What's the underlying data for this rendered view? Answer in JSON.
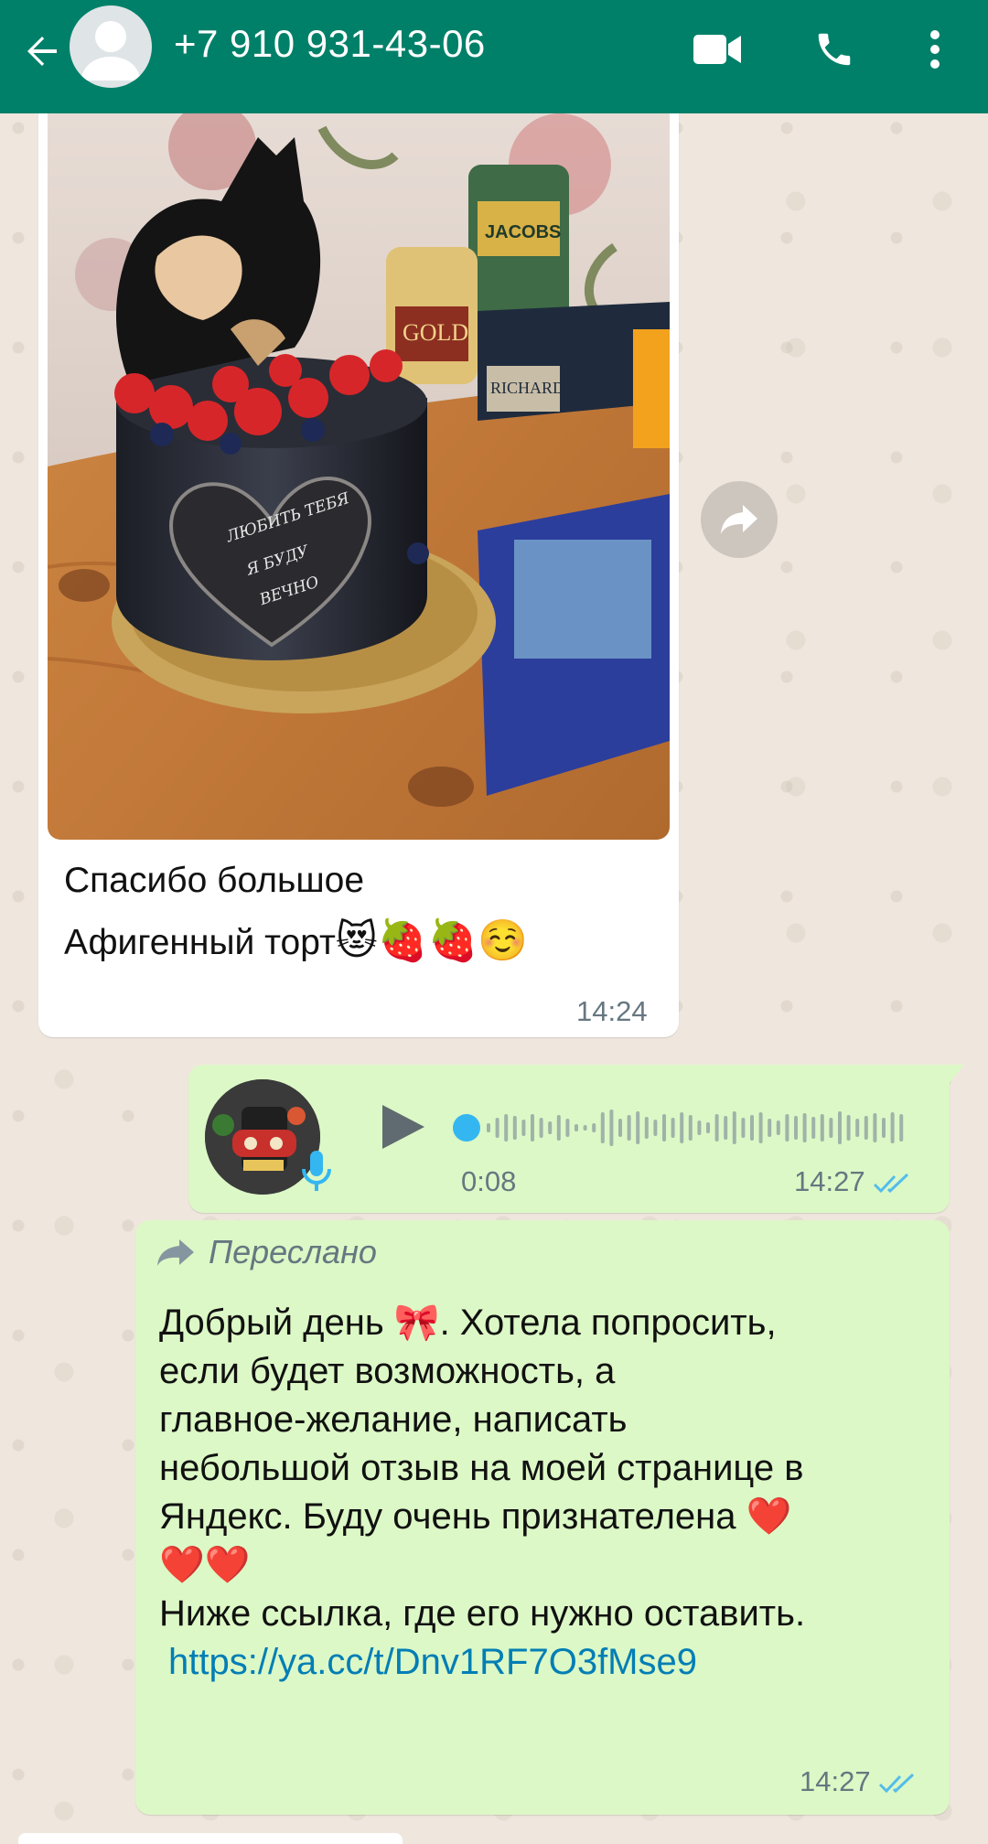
{
  "header": {
    "contact": "+7 910 931-43-06",
    "icons": [
      "back-arrow-icon",
      "avatar-placeholder-icon",
      "video-call-icon",
      "phone-call-icon",
      "more-vert-icon"
    ]
  },
  "incoming": {
    "photo_texts": {
      "heart_plaque": [
        "ЛЮБИТЬ ТЕБЯ",
        "Я БУДУ",
        "ВЕЧНО"
      ],
      "product_labels": [
        "JACOBS",
        "GOLD",
        "RICHARD"
      ]
    },
    "caption_line1": "Спасибо большое",
    "caption_line2": "Афигенный торт",
    "caption_emojis": "😻🍓🍓☺️",
    "time": "14:24"
  },
  "voice_message": {
    "duration": "0:08",
    "time": "14:27",
    "progress": 0.0
  },
  "forwarded": {
    "label": "Переслано",
    "line1": "Добрый день 🎀.  Хотела попросить,",
    "line2": "если будет возможность,  а",
    "line3": "главное-желание,  написать",
    "line4": "небольшой отзыв на моей странице в",
    "line5": "Яндекс.  Буду очень признателена ❤️",
    "line6": "❤️❤️",
    "line7": "Ниже ссылка, где его нужно оставить.",
    "link": "https://ya.cc/t/Dnv1RF7O3fMse9",
    "time": "14:27"
  },
  "colors": {
    "header": "#008069",
    "outgoing_bubble": "#dcf8c6",
    "incoming_bubble": "#ffffff",
    "read_ticks": "#53bdeb",
    "link": "#027eb5"
  }
}
